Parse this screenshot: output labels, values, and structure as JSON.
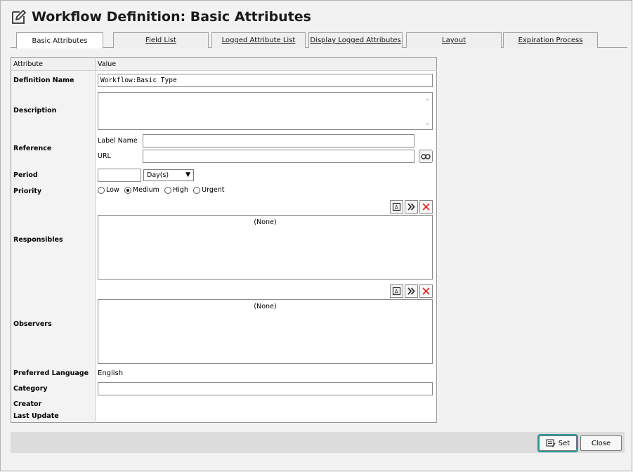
{
  "title": "Workflow Definition: Basic Attributes",
  "tabs": [
    {
      "label": "Basic Attributes"
    },
    {
      "label": "Field List"
    },
    {
      "label": "Logged Attribute List"
    },
    {
      "label": "Display Logged Attributes"
    },
    {
      "label": "Layout"
    },
    {
      "label": "Expiration Process"
    }
  ],
  "grid": {
    "header": {
      "attribute": "Attribute",
      "value": "Value"
    },
    "definition_name": {
      "label": "Definition Name",
      "value": "Workflow:Basic Type"
    },
    "description": {
      "label": "Description",
      "value": ""
    },
    "reference": {
      "label": "Reference",
      "label_name_label": "Label Name",
      "label_name_value": "",
      "url_label": "URL",
      "url_value": ""
    },
    "period": {
      "label": "Period",
      "value": "",
      "unit": "Day(s)"
    },
    "priority": {
      "label": "Priority",
      "options": [
        "Low",
        "Medium",
        "High",
        "Urgent"
      ],
      "selected": "Medium"
    },
    "responsibles": {
      "label": "Responsibles",
      "empty": "(None)"
    },
    "observers": {
      "label": "Observers",
      "empty": "(None)"
    },
    "preferred_language": {
      "label": "Preferred Language",
      "value": "English"
    },
    "category": {
      "label": "Category",
      "value": ""
    },
    "creator": {
      "label": "Creator",
      "value": ""
    },
    "last_update": {
      "label": "Last Update",
      "value": ""
    }
  },
  "footer": {
    "set_label": "Set",
    "close_label": "Close"
  },
  "colors": {
    "accent": "#2a9a9a",
    "delete": "#e03030"
  }
}
